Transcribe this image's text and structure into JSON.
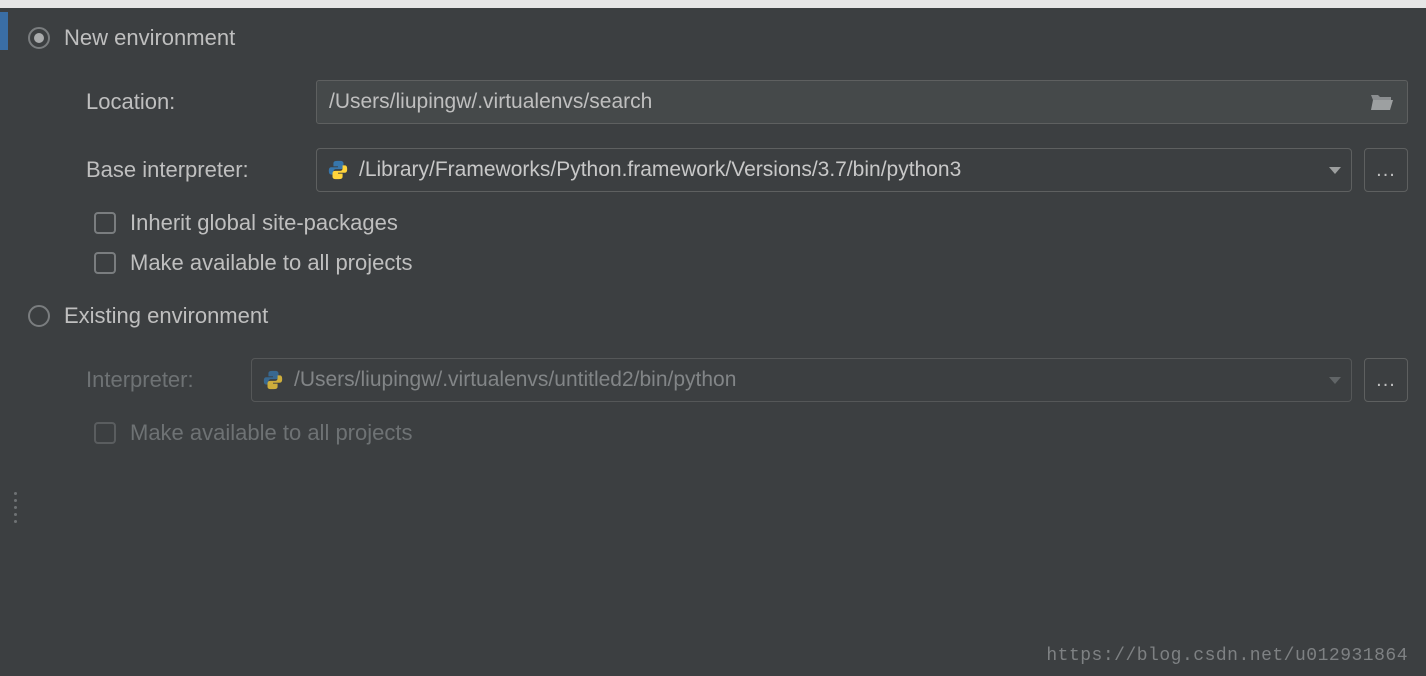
{
  "new_env": {
    "radio_label": "New environment",
    "location_label": "Location:",
    "location_value": "/Users/liupingw/.virtualenvs/search",
    "base_label": "Base interpreter:",
    "base_value": "/Library/Frameworks/Python.framework/Versions/3.7/bin/python3",
    "inherit_label": "Inherit global site-packages",
    "make_avail_label": "Make available to all projects"
  },
  "existing_env": {
    "radio_label": "Existing environment",
    "interpreter_label": "Interpreter:",
    "interpreter_value": "/Users/liupingw/.virtualenvs/untitled2/bin/python",
    "make_avail_label": "Make available to all projects"
  },
  "browse_label": "...",
  "watermark": "https://blog.csdn.net/u012931864"
}
